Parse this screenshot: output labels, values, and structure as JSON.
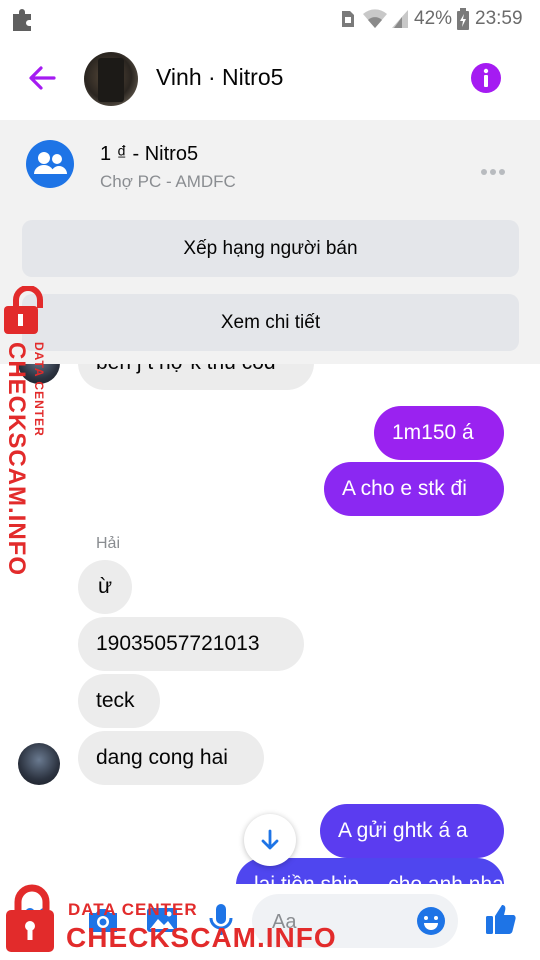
{
  "status_bar": {
    "battery": "42%",
    "time": "23:59"
  },
  "header": {
    "title": "Vinh · Nitro5"
  },
  "listing": {
    "title": "1 ₫ - Nitro5",
    "subtitle": "Chợ PC - AMDFC",
    "rate_button": "Xếp hạng người bán",
    "details_button": "Xem chi tiết"
  },
  "messages": {
    "partial_incoming": "bên j t nợ k thu cod",
    "out_1": "1m150 á",
    "out_2": "A cho e stk đi",
    "sender_name": "Hải",
    "in_1": "ừ",
    "in_2": "19035057721013",
    "in_3": "teck",
    "in_4": "dang cong hai",
    "out_3": "A gửi ghtk á a",
    "out_4": "lại tiền ship ... cho anh nha"
  },
  "composer": {
    "placeholder": "Aa"
  },
  "watermark": {
    "small": "DATA CENTER",
    "large": "CHECKSCAM.INFO"
  },
  "colors": {
    "accent": "#a51bf2",
    "blue_bubble": "#5b3cf0",
    "icon_blue": "#1e74e6",
    "watermark_red": "#e22b2b"
  }
}
